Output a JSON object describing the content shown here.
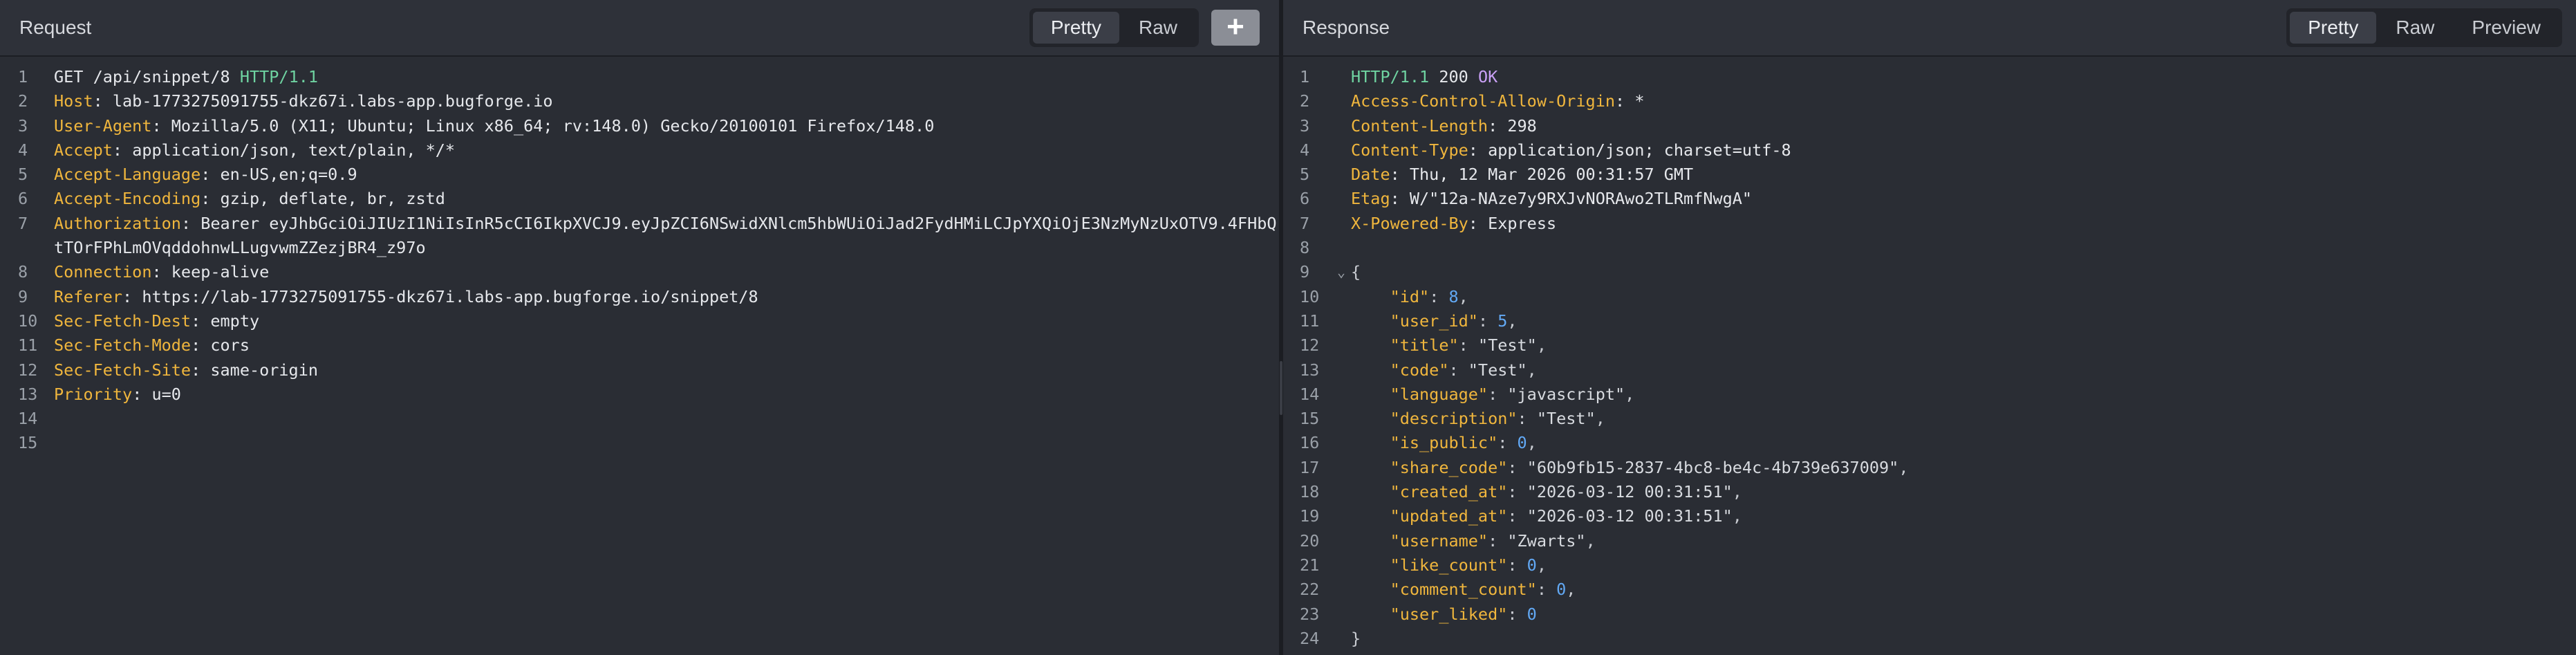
{
  "request": {
    "title": "Request",
    "views": [
      "Pretty",
      "Raw"
    ],
    "active_view": "Pretty",
    "add_label": "+",
    "line_numbers": [
      "1",
      "2",
      "3",
      "4",
      "5",
      "6",
      "7",
      "",
      "8",
      "9",
      "10",
      "11",
      "12",
      "13",
      "14",
      "15"
    ],
    "start_line": {
      "method": "GET",
      "path": " /api/snippet/8 ",
      "protocol": "HTTP/1.1"
    },
    "headers": [
      {
        "name": "Host",
        "value": "lab-1773275091755-dkz67i.labs-app.bugforge.io"
      },
      {
        "name": "User-Agent",
        "value": "Mozilla/5.0 (X11; Ubuntu; Linux x86_64; rv:148.0) Gecko/20100101 Firefox/148.0"
      },
      {
        "name": "Accept",
        "value": "application/json, text/plain, */*"
      },
      {
        "name": "Accept-Language",
        "value": "en-US,en;q=0.9"
      },
      {
        "name": "Accept-Encoding",
        "value": "gzip, deflate, br, zstd"
      },
      {
        "name": "Authorization",
        "value": "Bearer eyJhbGciOiJIUzI1NiIsInR5cCI6IkpXVCJ9.eyJpZCI6NSwidXNlcm5hbWUiOiJad2FydHMiLCJpYXQiOjE3NzMyNzUxOTV9.4FHbQtTOrFPhLmOVqddohnwLLugvwmZZezjBR4_z97o"
      },
      {
        "name": "Connection",
        "value": "keep-alive"
      },
      {
        "name": "Referer",
        "value": "https://lab-1773275091755-dkz67i.labs-app.bugforge.io/snippet/8"
      },
      {
        "name": "Sec-Fetch-Dest",
        "value": "empty"
      },
      {
        "name": "Sec-Fetch-Mode",
        "value": "cors"
      },
      {
        "name": "Sec-Fetch-Site",
        "value": "same-origin"
      },
      {
        "name": "Priority",
        "value": "u=0"
      }
    ]
  },
  "response": {
    "title": "Response",
    "views": [
      "Pretty",
      "Raw",
      "Preview"
    ],
    "active_view": "Pretty",
    "status_line": {
      "protocol": "HTTP/1.1",
      "code": " 200 ",
      "text": "OK"
    },
    "headers": [
      {
        "name": "Access-Control-Allow-Origin",
        "value": "*"
      },
      {
        "name": "Content-Length",
        "value": "298"
      },
      {
        "name": "Content-Type",
        "value": "application/json; charset=utf-8"
      },
      {
        "name": "Date",
        "value": "Thu, 12 Mar 2026 00:31:57 GMT"
      },
      {
        "name": "Etag",
        "value": "W/\"12a-NAze7y9RXJvNORAwo2TLRmfNwgA\""
      },
      {
        "name": "X-Powered-By",
        "value": "Express"
      }
    ],
    "fold_marker": "⌄",
    "open_brace": "{",
    "close_brace": "}",
    "body": [
      {
        "key": "\"id\"",
        "value": "8",
        "type": "num",
        "comma": ","
      },
      {
        "key": "\"user_id\"",
        "value": "5",
        "type": "num",
        "comma": ","
      },
      {
        "key": "\"title\"",
        "value": "\"Test\"",
        "type": "str",
        "comma": ","
      },
      {
        "key": "\"code\"",
        "value": "\"Test\"",
        "type": "str",
        "comma": ","
      },
      {
        "key": "\"language\"",
        "value": "\"javascript\"",
        "type": "str",
        "comma": ","
      },
      {
        "key": "\"description\"",
        "value": "\"Test\"",
        "type": "str",
        "comma": ","
      },
      {
        "key": "\"is_public\"",
        "value": "0",
        "type": "num",
        "comma": ","
      },
      {
        "key": "\"share_code\"",
        "value": "\"60b9fb15-2837-4bc8-be4c-4b739e637009\"",
        "type": "str",
        "comma": ","
      },
      {
        "key": "\"created_at\"",
        "value": "\"2026-03-12 00:31:51\"",
        "type": "str",
        "comma": ","
      },
      {
        "key": "\"updated_at\"",
        "value": "\"2026-03-12 00:31:51\"",
        "type": "str",
        "comma": ","
      },
      {
        "key": "\"username\"",
        "value": "\"Zwarts\"",
        "type": "str",
        "comma": ","
      },
      {
        "key": "\"like_count\"",
        "value": "0",
        "type": "num",
        "comma": ","
      },
      {
        "key": "\"comment_count\"",
        "value": "0",
        "type": "num",
        "comma": ","
      },
      {
        "key": "\"user_liked\"",
        "value": "0",
        "type": "num",
        "comma": ""
      }
    ]
  },
  "colors": {
    "header_name": "#f0b63d",
    "protocol_green": "#6fd3a1",
    "status_purple": "#c9a0f5",
    "number_blue": "#62a9f5",
    "background": "#2a2d34"
  }
}
